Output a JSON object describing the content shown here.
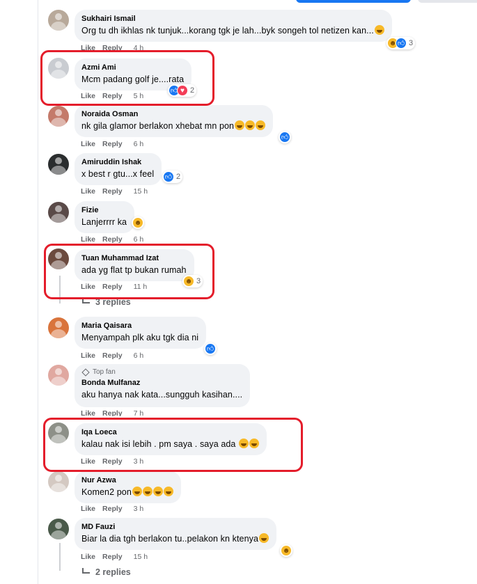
{
  "comments": [
    {
      "name": "Sukhairi Ismail",
      "text": "Org tu dh ikhlas nk tunjuk...korang tgk je lah...byk songeh tol netizen kan...",
      "like": "Like",
      "reply": "Reply",
      "time": "4 h",
      "reaction_count": "3",
      "avatar_color": "#b8a99a"
    },
    {
      "name": "Azmi Ami",
      "text": "Mcm padang golf je....rata",
      "like": "Like",
      "reply": "Reply",
      "time": "5 h",
      "reaction_count": "2",
      "avatar_color": "#c9ccd1"
    },
    {
      "name": "Noraida Osman",
      "text": "nk gila glamor berlakon xhebat mn pon",
      "like": "Like",
      "reply": "Reply",
      "time": "6 h",
      "reaction_count": "",
      "avatar_color": "#c47a6a"
    },
    {
      "name": "Amiruddin Ishak",
      "text": "x best r gtu...x feel",
      "like": "Like",
      "reply": "Reply",
      "time": "15 h",
      "reaction_count": "2",
      "avatar_color": "#2a2d2e"
    },
    {
      "name": "Fizie",
      "text": "Lanjerrrr ka",
      "like": "Like",
      "reply": "Reply",
      "time": "6 h",
      "reaction_count": "",
      "avatar_color": "#5a4a48"
    },
    {
      "name": "Tuan Muhammad Izat",
      "text": "ada yg flat tp bukan rumah",
      "like": "Like",
      "reply": "Reply",
      "time": "11 h",
      "reaction_count": "3",
      "replies": "3 replies",
      "avatar_color": "#6b4a3e"
    },
    {
      "name": "Maria Qaisara",
      "text": "Menyampah plk aku tgk dia ni",
      "like": "Like",
      "reply": "Reply",
      "time": "6 h",
      "reaction_count": "",
      "avatar_color": "#d9743c"
    },
    {
      "name": "Bonda Mulfanaz",
      "badge": "Top fan",
      "text": "aku hanya nak kata...sungguh kasihan....",
      "like": "Like",
      "reply": "Reply",
      "time": "7 h",
      "reaction_count": "",
      "avatar_color": "#e0a8a0"
    },
    {
      "name": "Iqa Loeca",
      "text": "kalau nak isi lebih . pm saya . saya ada",
      "like": "Like",
      "reply": "Reply",
      "time": "3 h",
      "reaction_count": "",
      "avatar_color": "#8d9088"
    },
    {
      "name": "Nur Azwa",
      "text": "Komen2 pon",
      "like": "Like",
      "reply": "Reply",
      "time": "3 h",
      "reaction_count": "",
      "avatar_color": "#d4c9c2"
    },
    {
      "name": "MD Fauzi",
      "text": "Biar la dia tgh berlakon tu..pelakon kn ktenya",
      "like": "Like",
      "reply": "Reply",
      "time": "15 h",
      "reaction_count": "",
      "replies": "2 replies",
      "avatar_color": "#4a5a4a"
    }
  ],
  "colors": {
    "highlight": "#e41d2b",
    "bubble": "#f0f2f5",
    "like_blue": "#1877f2"
  }
}
